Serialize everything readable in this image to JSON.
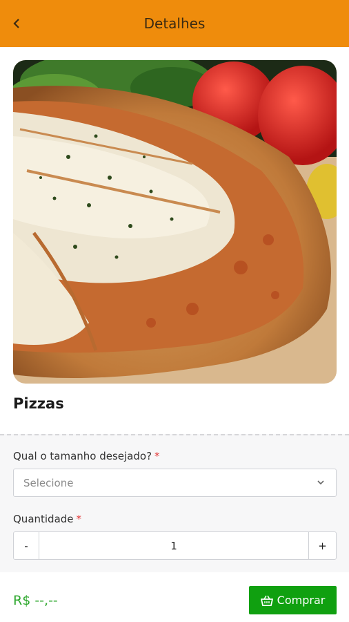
{
  "header": {
    "title": "Detalhes",
    "back_icon": "chevron-left-icon"
  },
  "product": {
    "name": "Pizzas",
    "image_alt": "pizza-photo"
  },
  "size_field": {
    "label": "Qual o tamanho desejado?",
    "required_mark": "*",
    "selected": "Selecione"
  },
  "quantity_field": {
    "label": "Quantidade",
    "required_mark": "*",
    "minus": "-",
    "value": "1",
    "plus": "+"
  },
  "footer": {
    "price": "R$ --,--",
    "buy_label": "Comprar",
    "buy_icon": "basket-icon"
  },
  "colors": {
    "header": "#ef8c0c",
    "buy": "#10a010",
    "price": "#2fa82f",
    "required": "#e23030"
  }
}
